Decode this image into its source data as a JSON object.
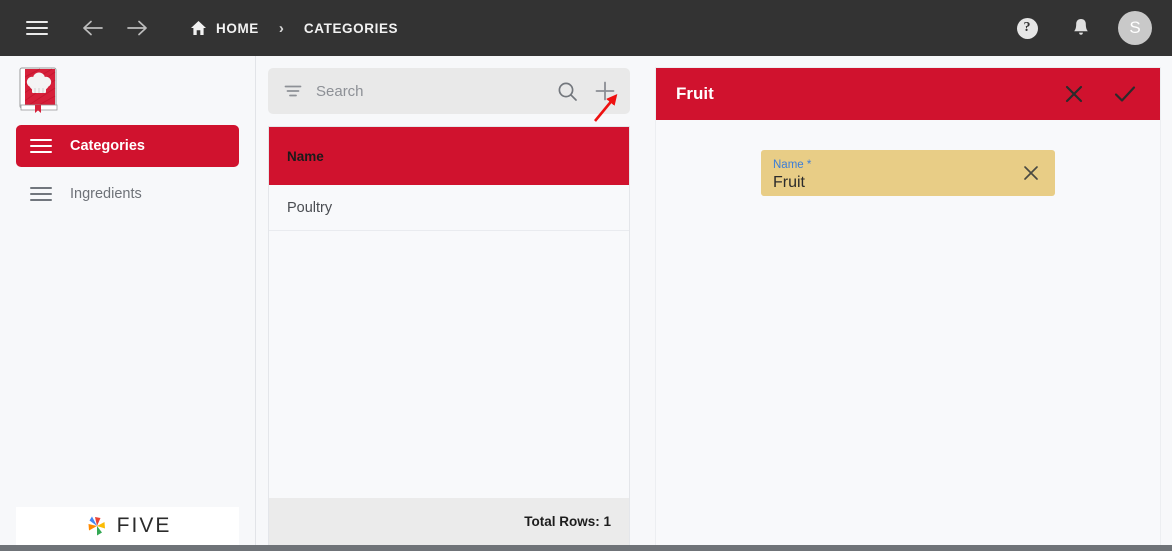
{
  "topbar": {
    "menu_icon": "hamburger-icon",
    "back_icon": "arrow-left-icon",
    "forward_icon": "arrow-right-icon",
    "breadcrumb": {
      "home_label": "HOME",
      "separator": "›",
      "current_label": "CATEGORIES"
    },
    "help_glyph": "?",
    "notification_icon": "bell-icon",
    "avatar_initial": "S",
    "background": "#333333"
  },
  "sidebar": {
    "logo_name": "cookbook-logo",
    "items": [
      {
        "label": "Categories",
        "active": true
      },
      {
        "label": "Ingredients",
        "active": false
      }
    ],
    "footer_brand": "FIVE",
    "accent": "#d0122e"
  },
  "list_panel": {
    "search": {
      "placeholder": "Search",
      "value": "",
      "filter_icon": "filter-icon",
      "search_icon": "magnifier-icon",
      "add_icon": "plus-icon"
    },
    "table": {
      "columns": [
        "Name"
      ],
      "rows": [
        {
          "name": "Poultry"
        }
      ],
      "footer_label": "Total Rows: 1",
      "header_background": "#d0122e"
    }
  },
  "detail_panel": {
    "title": "Fruit",
    "cancel_icon": "close-icon",
    "confirm_icon": "check-icon",
    "form": {
      "fields": [
        {
          "label": "Name *",
          "value": "Fruit",
          "clear_icon": "close-icon",
          "background": "#e8cd86",
          "label_color": "#3b7dd8"
        }
      ]
    }
  },
  "annotation": {
    "type": "arrow",
    "color": "#ee1111",
    "points_at": "plus-icon"
  }
}
